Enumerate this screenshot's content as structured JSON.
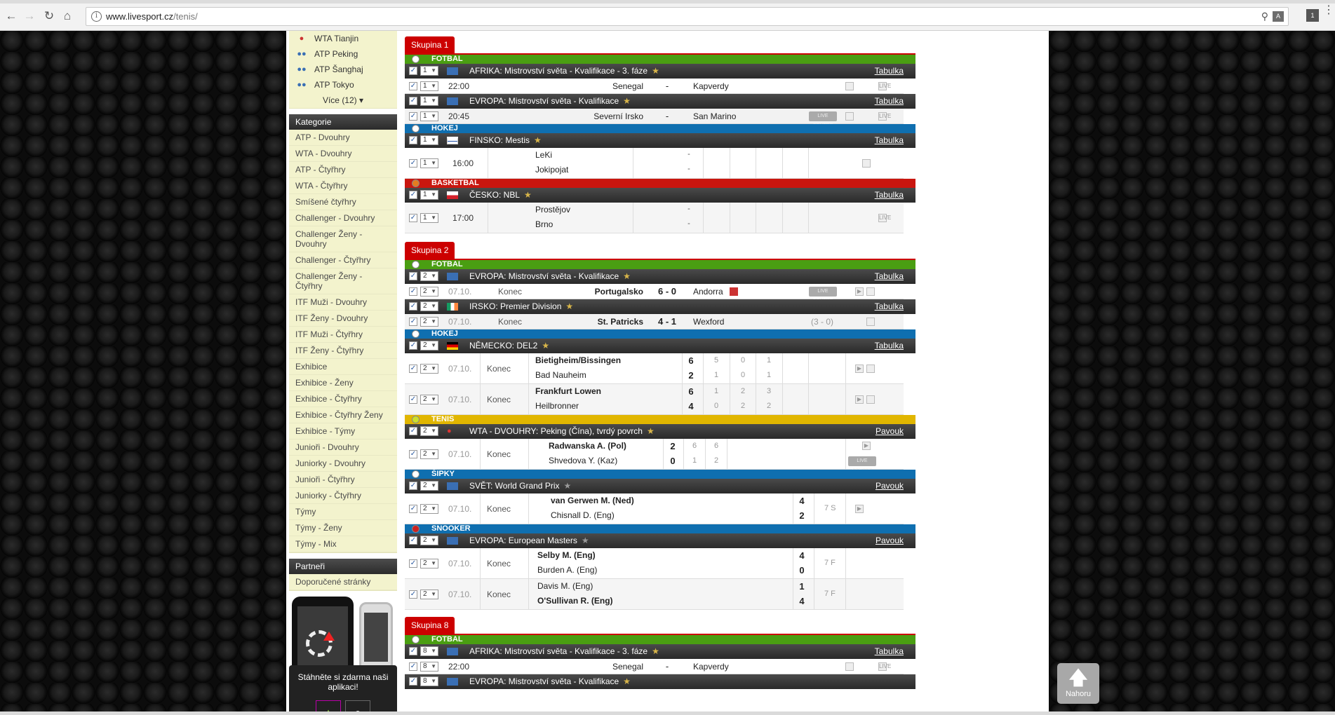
{
  "browser": {
    "url_host": "www.livesport.cz",
    "url_path": "/tenis/",
    "ext_badge": "1"
  },
  "sidebar": {
    "top_items": [
      "WTA Tianjin",
      "ATP Peking",
      "ATP Šanghaj",
      "ATP Tokyo"
    ],
    "more": "Více (12)",
    "kategorie_title": "Kategorie",
    "kategorie": [
      "ATP - Dvouhry",
      "WTA - Dvouhry",
      "ATP - Čtyřhry",
      "WTA - Čtyřhry",
      "Smíšené čtyřhry",
      "Challenger - Dvouhry",
      "Challenger Ženy - Dvouhry",
      "Challenger - Čtyřhry",
      "Challenger Ženy - Čtyřhry",
      "ITF Muži - Dvouhry",
      "ITF Ženy - Dvouhry",
      "ITF Muži - Čtyřhry",
      "ITF Ženy - Čtyřhry",
      "Exhibice",
      "Exhibice - Ženy",
      "Exhibice - Čtyřhry",
      "Exhibice - Čtyřhry Ženy",
      "Exhibice - Týmy",
      "Junioři - Dvouhry",
      "Juniorky - Dvouhry",
      "Junioři - Čtyřhry",
      "Juniorky - Čtyřhry",
      "Týmy",
      "Týmy - Ženy",
      "Týmy - Mix"
    ],
    "partneri_title": "Partneři",
    "partneri": [
      "Doporučené stránky"
    ],
    "app_text": "Stáhněte si zdarma naši aplikaci!"
  },
  "groups": {
    "g1": {
      "label": "Skupina 1",
      "sel": "1"
    },
    "g2": {
      "label": "Skupina 2",
      "sel": "2"
    },
    "g8": {
      "label": "Skupina 8",
      "sel": "8"
    }
  },
  "sports": {
    "fotbal": "FOTBAL",
    "hokej": "HOKEJ",
    "basket": "BASKETBAL",
    "tenis": "TENIS",
    "sipky": "ŠIPKY",
    "snooker": "SNOOKER"
  },
  "leagues": {
    "afrika": "AFRIKA: Mistrovství světa - Kvalifikace - 3. fáze",
    "evropa_kv": "EVROPA: Mistrovství světa - Kvalifikace",
    "finsko": "FINSKO: Mestis",
    "cesko": "ČESKO: NBL",
    "irsko": "IRSKO: Premier Division",
    "nemecko": "NĚMECKO: DEL2",
    "wta": "WTA - DVOUHRY: Peking (Čína), tvrdý povrch",
    "svet": "SVĚT: World Grand Prix",
    "evropa_masters": "EVROPA: European Masters",
    "evropa_kv_short": "EVROPA: Mistrovství světa - Kvalifikace"
  },
  "links": {
    "tabulka": "Tabulka",
    "pavouk": "Pavouk"
  },
  "matches": {
    "m1": {
      "time": "22:00",
      "home": "Senegal",
      "sep": "-",
      "away": "Kapverdy"
    },
    "m2": {
      "time": "20:45",
      "home": "Severní Irsko",
      "sep": "-",
      "away": "San Marino",
      "live": "LIVE CENTRE"
    },
    "m3": {
      "time": "16:00",
      "home": "LeKi",
      "away": "Jokipojat",
      "sep": "-"
    },
    "m4": {
      "time": "17:00",
      "home": "Prostějov",
      "away": "Brno",
      "sep": "-"
    },
    "m5": {
      "date": "07.10.",
      "status": "Konec",
      "home": "Portugalsko",
      "score": "6 - 0",
      "away": "Andorra",
      "live": "LIVE CENTRE"
    },
    "m6": {
      "date": "07.10.",
      "status": "Konec",
      "home": "St. Patricks",
      "score": "4 - 1",
      "away": "Wexford",
      "ht": "(3 - 0)"
    },
    "m7": {
      "date": "07.10.",
      "status": "Konec",
      "home": "Bietigheim/Bissingen",
      "away": "Bad Nauheim",
      "hs": "6",
      "as": "2",
      "hp": [
        "5",
        "0",
        "1"
      ],
      "ap": [
        "1",
        "0",
        "1"
      ]
    },
    "m8": {
      "date": "07.10.",
      "status": "Konec",
      "home": "Frankfurt Lowen",
      "away": "Heilbronner",
      "hs": "6",
      "as": "4",
      "hp": [
        "1",
        "2",
        "3"
      ],
      "ap": [
        "0",
        "2",
        "2"
      ]
    },
    "m9": {
      "date": "07.10.",
      "status": "Konec",
      "home": "Radwanska A. (Pol)",
      "away": "Shvedova Y. (Kaz)",
      "hs": "2",
      "as": "0",
      "hp": [
        "6",
        "6"
      ],
      "ap": [
        "1",
        "2"
      ],
      "live": "LIVE CENTRE"
    },
    "m10": {
      "date": "07.10.",
      "status": "Konec",
      "home": "van Gerwen M. (Ned)",
      "away": "Chisnall D. (Eng)",
      "hs": "4",
      "as": "2",
      "note": "7 S"
    },
    "m11": {
      "date": "07.10.",
      "status": "Konec",
      "home": "Selby M. (Eng)",
      "away": "Burden A. (Eng)",
      "hs": "4",
      "as": "0",
      "note": "7 F"
    },
    "m12": {
      "date": "07.10.",
      "status": "Konec",
      "home": "Davis M. (Eng)",
      "away": "O'Sullivan R. (Eng)",
      "hs": "1",
      "as": "4",
      "note": "7 F"
    },
    "m13": {
      "time": "22:00",
      "home": "Senegal",
      "sep": "-",
      "away": "Kapverdy"
    }
  },
  "nahoru": "Nahoru"
}
